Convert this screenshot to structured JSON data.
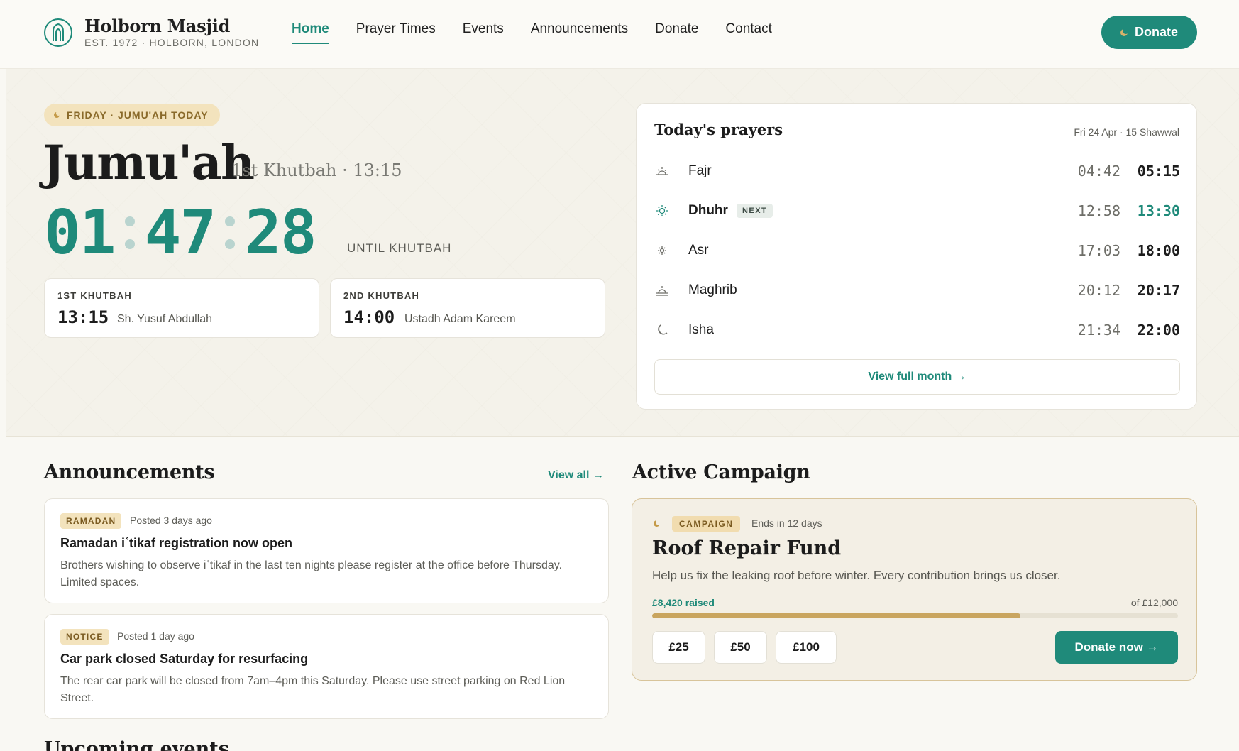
{
  "brand": {
    "name": "Holborn Masjid",
    "sub": "EST. 1972 · HOLBORN, LONDON"
  },
  "nav": [
    {
      "label": "Home",
      "active": true
    },
    {
      "label": "Prayer Times"
    },
    {
      "label": "Events"
    },
    {
      "label": "Announcements"
    },
    {
      "label": "Donate"
    },
    {
      "label": "Contact"
    }
  ],
  "header_donate": "Donate",
  "hero": {
    "pill": "FRIDAY · JUMU'AH TODAY",
    "title": "Jumu'ah",
    "subtitle": "1st Khutbah · 13:15",
    "countdown": {
      "h": "01",
      "m": "47",
      "s": "28"
    },
    "until": "UNTIL KHUTBAH",
    "khutbahs": [
      {
        "label": "1ST KHUTBAH",
        "time": "13:15",
        "imam": "Sh. Yusuf Abdullah"
      },
      {
        "label": "2ND KHUTBAH",
        "time": "14:00",
        "imam": "Ustadh Adam Kareem"
      }
    ]
  },
  "prayers": {
    "title": "Today's prayers",
    "date": "Fri 24 Apr · 15 Shawwal",
    "next_badge": "NEXT",
    "rows": [
      {
        "name": "Fajr",
        "icon": "sunrise-icon",
        "begin": "04:42",
        "jamaah": "05:15"
      },
      {
        "name": "Dhuhr",
        "icon": "sun-icon",
        "begin": "12:58",
        "jamaah": "13:30",
        "next": true
      },
      {
        "name": "Asr",
        "icon": "sun-small-icon",
        "begin": "17:03",
        "jamaah": "18:00"
      },
      {
        "name": "Maghrib",
        "icon": "sunset-icon",
        "begin": "20:12",
        "jamaah": "20:17"
      },
      {
        "name": "Isha",
        "icon": "moon-icon",
        "begin": "21:34",
        "jamaah": "22:00"
      }
    ],
    "view_month": "View full month →"
  },
  "announcements": {
    "title": "Announcements",
    "view_all": "View all →",
    "items": [
      {
        "tag": "RAMADAN",
        "posted": "Posted 3 days ago",
        "title": "Ramadan iʿtikaf registration now open",
        "body": "Brothers wishing to observe iʿtikaf in the last ten nights please register at the office before Thursday. Limited spaces."
      },
      {
        "tag": "NOTICE",
        "posted": "Posted 1 day ago",
        "title": "Car park closed Saturday for resurfacing",
        "body": "The rear car park will be closed from 7am–4pm this Saturday. Please use street parking on Red Lion Street."
      }
    ]
  },
  "campaign": {
    "section_title": "Active Campaign",
    "tag": "CAMPAIGN",
    "ends": "Ends in 12 days",
    "title": "Roof Repair Fund",
    "description": "Help us fix the leaking roof before winter. Every contribution brings us closer.",
    "raised": "£8,420 raised",
    "goal": "of £12,000",
    "progress": 0.7,
    "amounts": [
      "£25",
      "£50",
      "£100"
    ],
    "donate_now": "Donate now →"
  },
  "upcoming_title": "Upcoming events",
  "colors": {
    "accent": "#1f8a7a",
    "gold": "#c9a55f",
    "tag_bg": "#f3e3bd"
  }
}
